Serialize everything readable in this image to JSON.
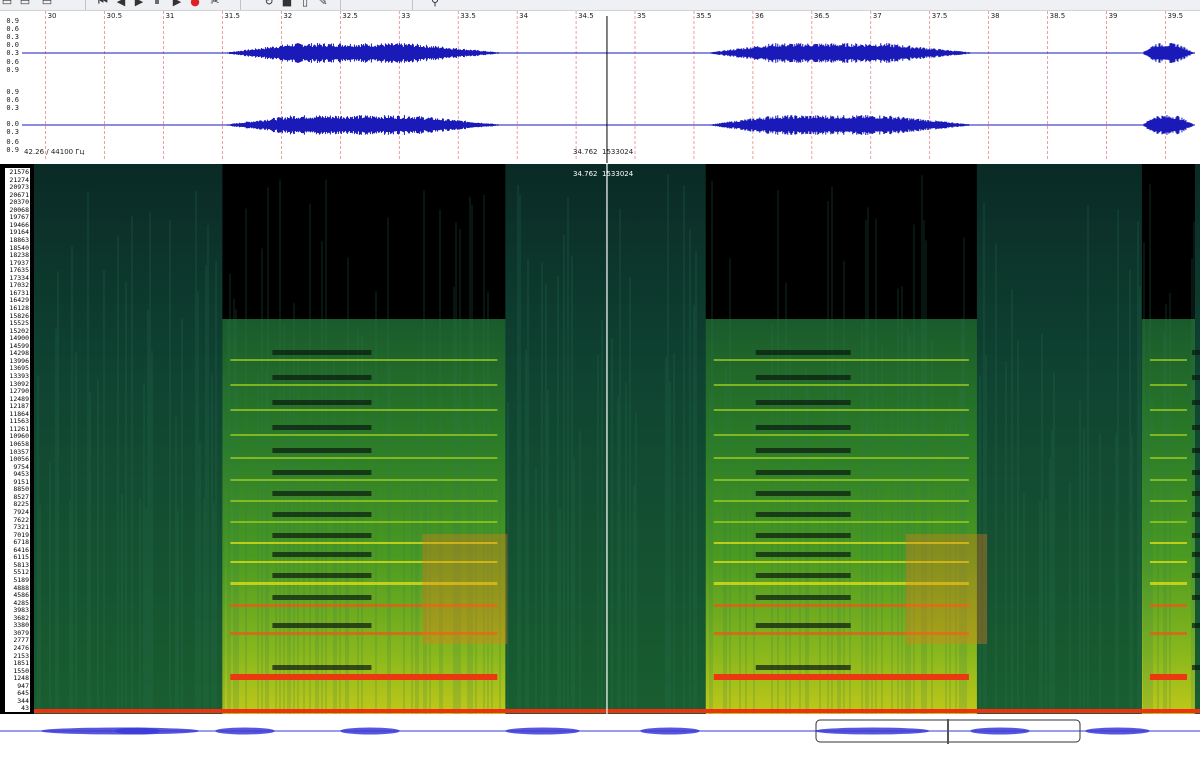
{
  "toolbar": {
    "buttons": [
      {
        "icon": "open-file-icon",
        "glyph": "▭"
      },
      {
        "icon": "save-icon",
        "glyph": "▭"
      },
      {
        "icon": "save-as-icon",
        "glyph": "▭"
      },
      {
        "icon": "skip-back-icon",
        "glyph": "⏮"
      },
      {
        "icon": "rewind-icon",
        "glyph": "◀"
      },
      {
        "icon": "play-icon",
        "glyph": "▶"
      },
      {
        "icon": "pause-icon",
        "glyph": "⏸"
      },
      {
        "icon": "fast-forward-icon",
        "glyph": "▶"
      },
      {
        "icon": "record-icon",
        "glyph": "●"
      },
      {
        "icon": "cut-icon",
        "glyph": "✂"
      },
      {
        "icon": "loop-icon",
        "glyph": "↻"
      },
      {
        "icon": "stop-icon",
        "glyph": "■"
      },
      {
        "icon": "select-tool-icon",
        "glyph": "▯"
      },
      {
        "icon": "pencil-icon",
        "glyph": "✎"
      },
      {
        "icon": "zoom-icon",
        "glyph": "⚲"
      }
    ]
  },
  "waveform": {
    "time_ticks": [
      "30",
      "30.5",
      "31",
      "31.5",
      "32",
      "32.5",
      "33",
      "33.5",
      "34",
      "34.5",
      "35",
      "35.5",
      "36",
      "36.5",
      "37",
      "37.5",
      "38",
      "38.5",
      "39",
      "39.5"
    ],
    "time_start": 29.8,
    "time_end": 39.75,
    "amp_labels_ch1": [
      "0.9",
      "0.6",
      "0.3",
      "0.0",
      "0.3",
      "0.6",
      "0.9"
    ],
    "amp_labels_ch2": [
      "0.9",
      "0.6",
      "0.3",
      "0.0",
      "0.3",
      "0.6",
      "0.9"
    ],
    "sample_rate_label": "42.26 / 44100 Гц",
    "cursor_time": "34.762",
    "cursor_sample": "1533024",
    "cursor_time_value": 34.762,
    "color": "#1a1ab8",
    "gridline_color": "#e06060",
    "bursts": [
      {
        "start": 31.5,
        "end": 33.9
      },
      {
        "start": 35.6,
        "end": 37.9
      },
      {
        "start": 39.3,
        "end": 39.75
      }
    ]
  },
  "spectrogram": {
    "freq_labels": [
      "21576",
      "21274",
      "20973",
      "20671",
      "20370",
      "20068",
      "19767",
      "19466",
      "19164",
      "18863",
      "18540",
      "18238",
      "17937",
      "17635",
      "17334",
      "17032",
      "16731",
      "16429",
      "16128",
      "15826",
      "15525",
      "15202",
      "14900",
      "14599",
      "14298",
      "13996",
      "13695",
      "13393",
      "13092",
      "12790",
      "12489",
      "12187",
      "11864",
      "11563",
      "11261",
      "10960",
      "10658",
      "10357",
      "10056",
      "9754",
      "9453",
      "9151",
      "8850",
      "8527",
      "8225",
      "7924",
      "7622",
      "7321",
      "7019",
      "6718",
      "6416",
      "6115",
      "5813",
      "5512",
      "5189",
      "4888",
      "4586",
      "4285",
      "3983",
      "3682",
      "3380",
      "3079",
      "2777",
      "2476",
      "2153",
      "1851",
      "1550",
      "1248",
      "947",
      "645",
      "344",
      "43"
    ],
    "cursor_time": "34.762",
    "cursor_sample": "1533024",
    "colors": {
      "background": "#000000",
      "low": "#0c3b2e",
      "mid": "#2e8f2a",
      "high": "#e6e01a",
      "peak": "#f03010"
    }
  },
  "overview": {
    "color": "#3a3ad8",
    "viewport_start": 0.68,
    "viewport_end": 0.9,
    "cursor_position": 0.79
  }
}
